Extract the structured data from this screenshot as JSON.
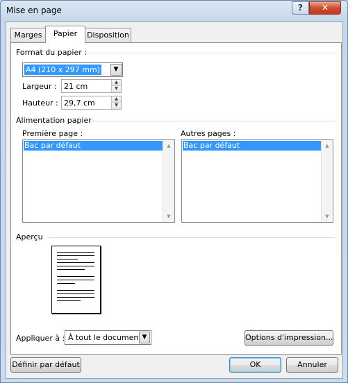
{
  "window": {
    "title": "Mise en page",
    "help_label": "?",
    "close_label": "✕"
  },
  "tabs": [
    {
      "label": "Marges",
      "active": false
    },
    {
      "label": "Papier",
      "active": true
    },
    {
      "label": "Disposition",
      "active": false
    }
  ],
  "paper": {
    "group_label": "Format du papier :",
    "size_value": "A4 (210 x 297 mm)",
    "width_label": "Largeur :",
    "width_value": "21 cm",
    "height_label": "Hauteur :",
    "height_value": "29,7 cm"
  },
  "source": {
    "group_label": "Alimentation papier",
    "first_page_label": "Première page :",
    "first_page_items": [
      "Bac par défaut"
    ],
    "other_pages_label": "Autres pages :",
    "other_pages_items": [
      "Bac par défaut"
    ]
  },
  "preview": {
    "group_label": "Aperçu"
  },
  "apply": {
    "label": "Appliquer à :",
    "value": "À tout le document"
  },
  "buttons": {
    "print_options": "Options d'impression...",
    "set_default": "Définir par défaut",
    "ok": "OK",
    "cancel": "Annuler"
  },
  "icons": {
    "dropdown": "chevron-down-icon",
    "spin_up": "triangle-up-icon",
    "spin_down": "triangle-down-icon"
  }
}
